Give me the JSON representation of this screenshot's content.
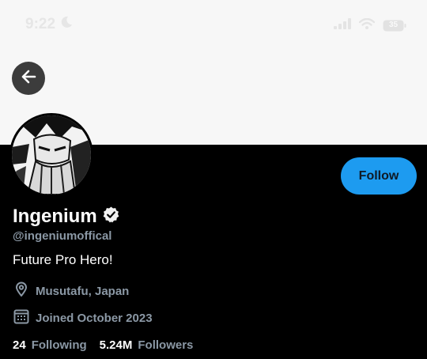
{
  "status_bar": {
    "time": "9:22",
    "moon_icon": "moon-icon",
    "signal_icon": "signal-icon",
    "wifi_icon": "wifi-icon",
    "battery_level": "35"
  },
  "header": {
    "back_icon": "arrow-left-icon"
  },
  "profile": {
    "display_name": "Ingenium",
    "verified_icon": "verified-badge-icon",
    "handle": "@ingeniumoffical",
    "bio": "Future Pro Hero!",
    "location": "Musutafu, Japan",
    "location_icon": "map-pin-icon",
    "joined": "Joined October 2023",
    "calendar_icon": "calendar-icon",
    "following_count": "24",
    "following_label": "Following",
    "followers_count": "5.24M",
    "followers_label": "Followers"
  },
  "actions": {
    "follow_label": "Follow"
  },
  "colors": {
    "accent": "#1d9bf0",
    "muted_text": "#8b98a5",
    "background": "#000000",
    "banner": "#f7f7f7"
  }
}
